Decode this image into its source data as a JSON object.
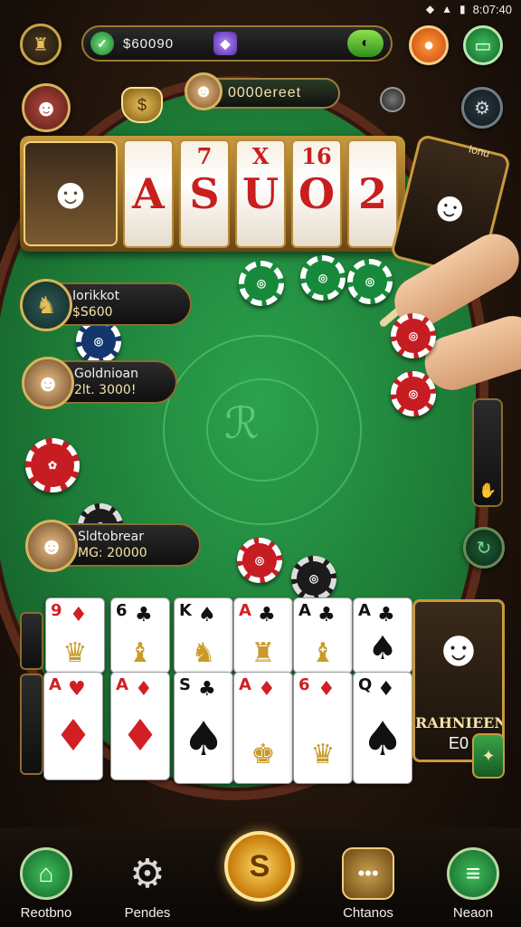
{
  "status_bar": {
    "time": "8:07:40",
    "icons": [
      "wifi-icon",
      "signal-icon",
      "battery-icon"
    ]
  },
  "top_bar": {
    "balance": "$60090",
    "left_gem_icon": "green-gem-icon",
    "right_gem_icon": "purple-gem-icon",
    "end_icon": "timer-icon"
  },
  "pot": {
    "value": "0000ereet"
  },
  "slot": {
    "reels": [
      {
        "top": "",
        "symbol": "A"
      },
      {
        "top": "7",
        "symbol": "S"
      },
      {
        "top": "X",
        "symbol": "U"
      },
      {
        "top": "16",
        "symbol": "O"
      },
      {
        "top": "",
        "symbol": "2"
      }
    ]
  },
  "phone_card": {
    "label": "Ionu"
  },
  "players": [
    {
      "name": "Iorikkot",
      "chips": "$S600"
    },
    {
      "name": "Goldnioan",
      "chips": "2lt. 3000!"
    },
    {
      "name": "Sldtobrear",
      "chips": "MG: 20000"
    }
  ],
  "cards_top": [
    {
      "rank": "9",
      "color": "red",
      "suit": "♦"
    },
    {
      "rank": "6",
      "color": "black",
      "suit": "♣"
    },
    {
      "rank": "K",
      "color": "black",
      "suit": "♠"
    },
    {
      "rank": "A",
      "color": "red",
      "suit": "♣"
    },
    {
      "rank": "A",
      "color": "black",
      "suit": "♣"
    },
    {
      "rank": "A",
      "color": "black",
      "suit": "♣"
    }
  ],
  "cards_bottom": [
    {
      "rank": "A",
      "color": "red",
      "suit": "♥"
    },
    {
      "rank": "A",
      "color": "red",
      "suit": "♦"
    },
    {
      "rank": "S",
      "color": "black",
      "suit": "♣"
    },
    {
      "rank": "A",
      "color": "red",
      "suit": "♦"
    },
    {
      "rank": "6",
      "color": "red",
      "suit": "♦"
    },
    {
      "rank": "Q",
      "color": "black",
      "suit": "♦"
    }
  ],
  "portrait_card": {
    "name": "RAHNIEEN",
    "number": "E0"
  },
  "bottom_nav": {
    "items": [
      {
        "label": "Reotbno"
      },
      {
        "label": "Pendes"
      },
      {
        "label": "Chtanos"
      },
      {
        "label": "Neaon"
      }
    ],
    "center_symbol": "S"
  },
  "colors": {
    "felt": "#1d7a36",
    "rim": "#4a1f14",
    "gold": "#c79a3d"
  }
}
